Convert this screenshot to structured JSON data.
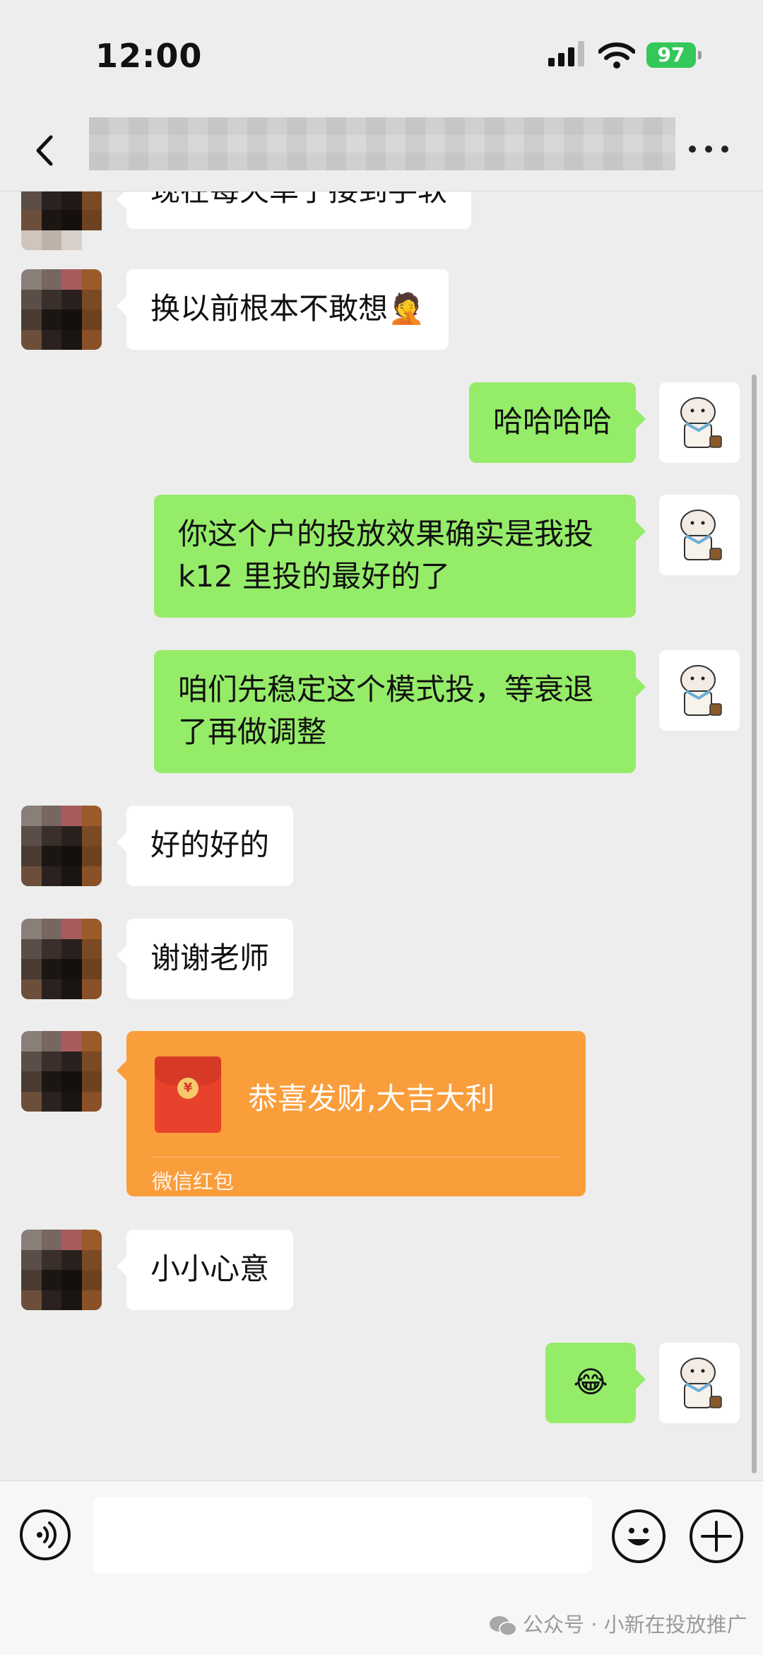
{
  "status": {
    "time": "12:00",
    "battery": "97"
  },
  "messages": [
    {
      "side": "left",
      "text": "现在每天单子接到手软"
    },
    {
      "side": "left",
      "text": "换以前根本不敢想🤦"
    },
    {
      "side": "right",
      "text": "哈哈哈哈"
    },
    {
      "side": "right",
      "text": "你这个户的投放效果确实是我投 k12 里投的最好的了"
    },
    {
      "side": "right",
      "text": "咱们先稳定这个模式投，等衰退了再做调整"
    },
    {
      "side": "left",
      "text": "好的好的"
    },
    {
      "side": "left",
      "text": "谢谢老师"
    },
    {
      "side": "left",
      "type": "red-packet",
      "text": "恭喜发财,大吉大利",
      "label": "微信红包"
    },
    {
      "side": "left",
      "text": "小小心意"
    },
    {
      "side": "right",
      "text": "😂"
    }
  ],
  "input": {
    "value": "",
    "placeholder": ""
  },
  "watermark": "公众号 · 小新在投放推广",
  "colors": {
    "bubble_self": "#95ec69",
    "bubble_other": "#ffffff",
    "red_packet": "#fa9d3b",
    "background": "#ededed"
  },
  "icons": [
    "back-icon",
    "more-icon",
    "voice-icon",
    "emoji-icon",
    "plus-icon",
    "red-packet-icon",
    "wechat-icon"
  ]
}
